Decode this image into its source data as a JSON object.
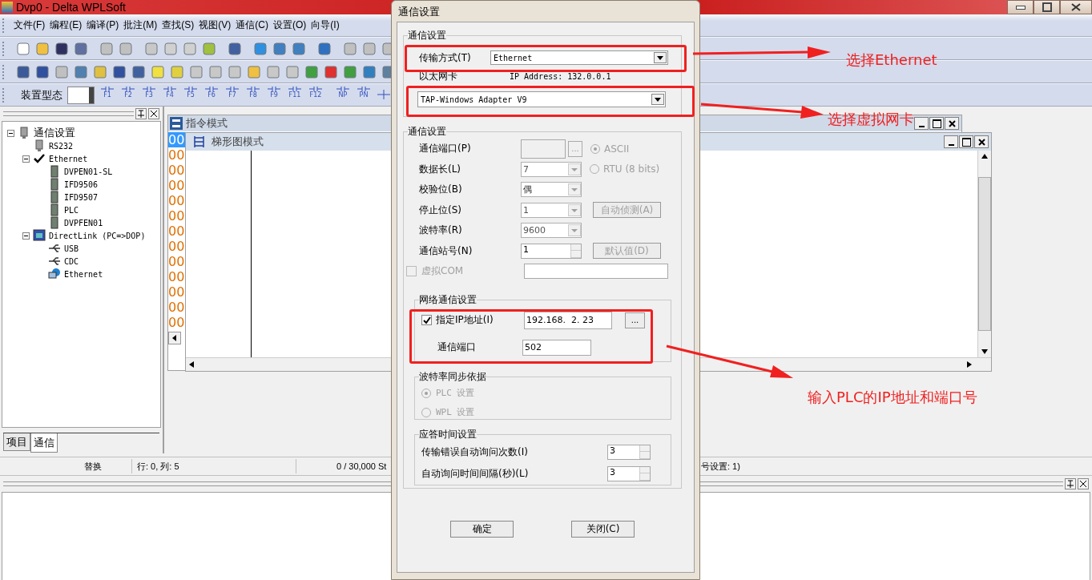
{
  "main_window": {
    "title": "Dvp0 - Delta WPLSoft"
  },
  "menu": [
    {
      "label": "文件(F)"
    },
    {
      "label": "编程(E)"
    },
    {
      "label": "编译(P)"
    },
    {
      "label": "批注(M)"
    },
    {
      "label": "查找(S)"
    },
    {
      "label": "视图(V)"
    },
    {
      "label": "通信(C)"
    },
    {
      "label": "设置(O)"
    },
    {
      "label": "向导(I)"
    }
  ],
  "device_toolbar": {
    "label": "装置型态",
    "keys": [
      "F1",
      "F2",
      "F3",
      "F4",
      "F5",
      "F6",
      "F7",
      "F8",
      "F9",
      "F11",
      "F12",
      "NP",
      "PN"
    ]
  },
  "project_panel": {
    "tree": [
      {
        "label": "通信设置",
        "kind": "serial",
        "expanded": true,
        "children": [
          {
            "label": "RS232",
            "kind": "serial"
          },
          {
            "label": "Ethernet",
            "kind": "check",
            "expanded": true,
            "children": [
              {
                "label": "DVPEN01-SL",
                "kind": "module"
              },
              {
                "label": "IFD9506",
                "kind": "module"
              },
              {
                "label": "IFD9507",
                "kind": "module"
              },
              {
                "label": "PLC",
                "kind": "module"
              },
              {
                "label": "DVPFEN01",
                "kind": "module"
              }
            ]
          },
          {
            "label": "DirectLink (PC=>DOP)",
            "kind": "link",
            "expanded": true,
            "children": [
              {
                "label": "USB",
                "kind": "usb"
              },
              {
                "label": "CDC",
                "kind": "usb"
              },
              {
                "label": "Ethernet",
                "kind": "network"
              }
            ]
          }
        ]
      }
    ],
    "tabs": [
      {
        "label": "项目",
        "selected": false
      },
      {
        "label": "通信",
        "selected": true
      }
    ]
  },
  "instruction_window": {
    "title": "指令模式",
    "rows": [
      {
        "text": "00",
        "selected": true
      },
      {
        "text": "00",
        "selected": false
      },
      {
        "text": "00",
        "selected": false
      },
      {
        "text": "00",
        "selected": false
      },
      {
        "text": "00",
        "selected": false
      },
      {
        "text": "00",
        "selected": false
      },
      {
        "text": "00",
        "selected": false
      },
      {
        "text": "00",
        "selected": false
      },
      {
        "text": "00",
        "selected": false
      },
      {
        "text": "00",
        "selected": false
      },
      {
        "text": "00",
        "selected": false
      },
      {
        "text": "00",
        "selected": false
      },
      {
        "text": "00",
        "selected": false
      }
    ]
  },
  "ladder_window": {
    "title": "梯形图模式"
  },
  "status_bar": [
    "替换",
    "行: 0, 列: 5",
    "0 / 30,000 St",
    "号设置: 1)"
  ],
  "dialog": {
    "title": "通信设置",
    "connection": {
      "title": "通信设置",
      "transport_label": "传输方式(T)",
      "transport_value": "Ethernet",
      "adapter_label": "以太网卡",
      "ip_address": "IP Address: 132.0.0.1",
      "adapter_value": "TAP-Windows Adapter V9"
    },
    "serial": {
      "title": "通信设置",
      "port": {
        "label": "通信端口(P)",
        "browse": "..."
      },
      "selects": [
        {
          "label": "数据长(L)",
          "value": "7"
        },
        {
          "label": "校验位(B)",
          "value": "偶"
        },
        {
          "label": "停止位(S)",
          "value": "1"
        },
        {
          "label": "波特率(R)",
          "value": "9600"
        }
      ],
      "station": {
        "label": "通信站号(N)",
        "value": "1"
      },
      "modes": [
        {
          "label": "ASCII",
          "selected": true,
          "disabled": true
        },
        {
          "label": "RTU (8 bits)",
          "selected": false,
          "disabled": true
        }
      ],
      "auto_detect": {
        "label": "自动侦测(A)",
        "disabled": true
      },
      "defaults": {
        "label": "默认值(D)",
        "disabled": true
      },
      "virtual_com": {
        "label": "虚拟COM",
        "checked": false,
        "disabled": true
      }
    },
    "network": {
      "title": "网络通信设置",
      "specify_ip": {
        "label": "指定IP地址(I)",
        "checked": true
      },
      "ip_value": "192.168.  2. 23",
      "browse": "...",
      "port_label": "通信端口",
      "port_value": "502"
    },
    "baud_sync": {
      "title": "波特率同步依据",
      "options": [
        {
          "label": "PLC 设置",
          "selected": true,
          "disabled": true
        },
        {
          "label": "WPL 设置",
          "selected": false,
          "disabled": true
        }
      ]
    },
    "response": {
      "title": "应答时间设置",
      "rows": [
        {
          "label": "传输错误自动询问次数(I)",
          "value": "3"
        },
        {
          "label": "自动询问时间间隔(秒)(L)",
          "value": "3"
        }
      ]
    },
    "buttons": [
      "确定",
      "关闭(C)"
    ]
  },
  "annotations": [
    {
      "text": "选择Ethernet"
    },
    {
      "text": "选择虚拟网卡"
    },
    {
      "text": "输入PLC的IP地址和端口号"
    }
  ]
}
